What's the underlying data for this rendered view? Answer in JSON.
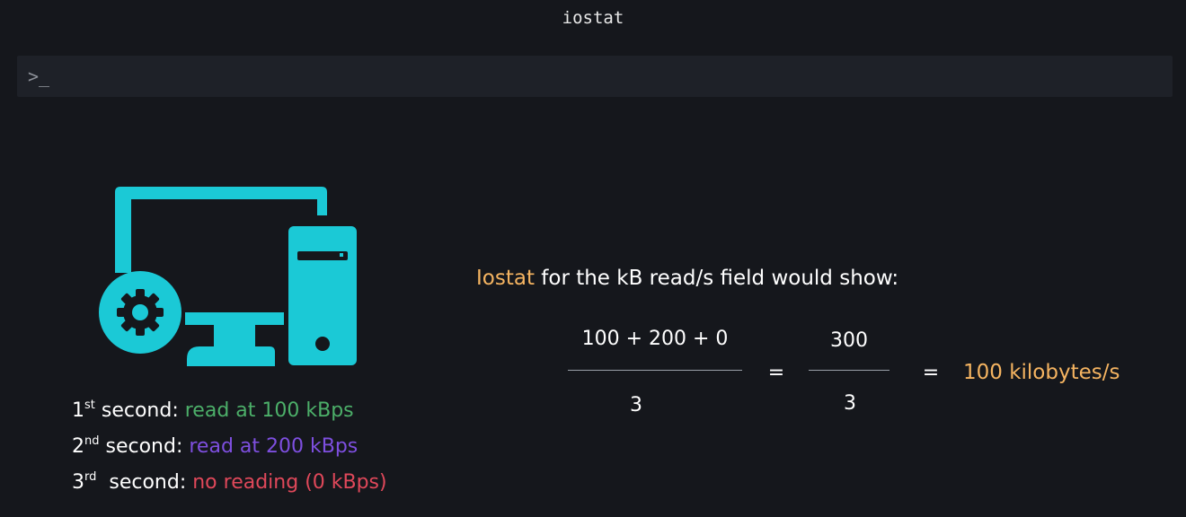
{
  "window": {
    "title": "iostat"
  },
  "terminal": {
    "prompt": ">_"
  },
  "illustration": {
    "icon": "desktop-computer-with-gear-icon",
    "color": "#1bc9d6"
  },
  "readings": [
    {
      "ordinal": "1",
      "suffix": "st",
      "label": " second: ",
      "value": "read at 100 kBps",
      "color": "#4caf69"
    },
    {
      "ordinal": "2",
      "suffix": "nd",
      "label": " second: ",
      "value": "read at 200 kBps",
      "color": "#7e4fe0"
    },
    {
      "ordinal": "3",
      "suffix": "rd",
      "label": "  second: ",
      "value": "no reading (0 kBps)",
      "color": "#e0485a"
    }
  ],
  "equation": {
    "heading_highlight": "Iostat",
    "heading_rest": " for the kB read/s field would show:",
    "fraction1": {
      "numerator": "100 + 200 + 0",
      "denominator": "3"
    },
    "equals1": "=",
    "fraction2": {
      "numerator": "300",
      "denominator": "3"
    },
    "equals2": "=",
    "result": "100 kilobytes/s",
    "highlight_color": "#f5b461"
  }
}
